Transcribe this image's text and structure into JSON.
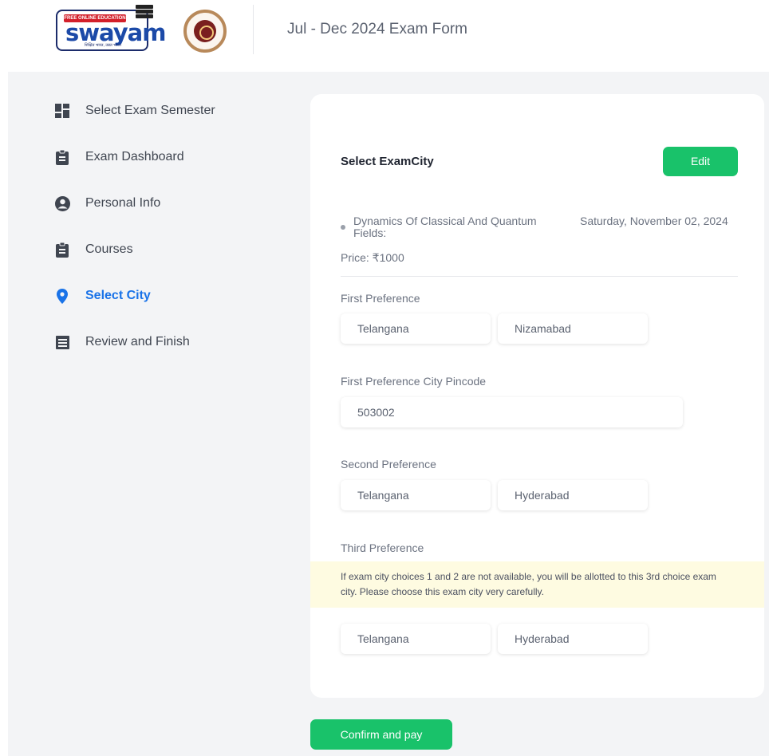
{
  "header": {
    "title": "Jul - Dec 2024 Exam Form",
    "logo": {
      "tagline": "FREE ONLINE EDUCATION",
      "word": "swayam",
      "subtext": "शिक्षित भारत, उन्नत भारत"
    }
  },
  "sidebar": {
    "items": [
      {
        "label": "Select Exam Semester",
        "icon": "dashboard-grid-icon"
      },
      {
        "label": "Exam Dashboard",
        "icon": "clipboard-icon"
      },
      {
        "label": "Personal Info",
        "icon": "user-circle-icon"
      },
      {
        "label": "Courses",
        "icon": "clipboard-icon"
      },
      {
        "label": "Select City",
        "icon": "location-pin-icon",
        "active": true
      },
      {
        "label": "Review and Finish",
        "icon": "list-document-icon"
      }
    ]
  },
  "card": {
    "title": "Select ExamCity",
    "edit_label": "Edit",
    "course": {
      "name": "Dynamics Of Classical And Quantum Fields:",
      "date": "Saturday, November 02, 2024",
      "price": "Price: ₹1000"
    },
    "first_preference": {
      "label": "First Preference",
      "state": "Telangana",
      "city": "Nizamabad"
    },
    "pincode": {
      "label": "First Preference City Pincode",
      "value": "503002"
    },
    "second_preference": {
      "label": "Second Preference",
      "state": "Telangana",
      "city": "Hyderabad"
    },
    "third_preference": {
      "label": "Third Preference",
      "notice": "If exam city choices 1 and 2 are not available, you will be allotted to this 3rd choice exam city. Please choose this exam city very carefully.",
      "state": "Telangana",
      "city": "Hyderabad"
    }
  },
  "confirm_label": "Confirm and pay",
  "colors": {
    "accent": "#1a73e8",
    "button": "#19c26a",
    "notice_bg": "#fefbe1",
    "page_bg": "#f3f4f6"
  }
}
